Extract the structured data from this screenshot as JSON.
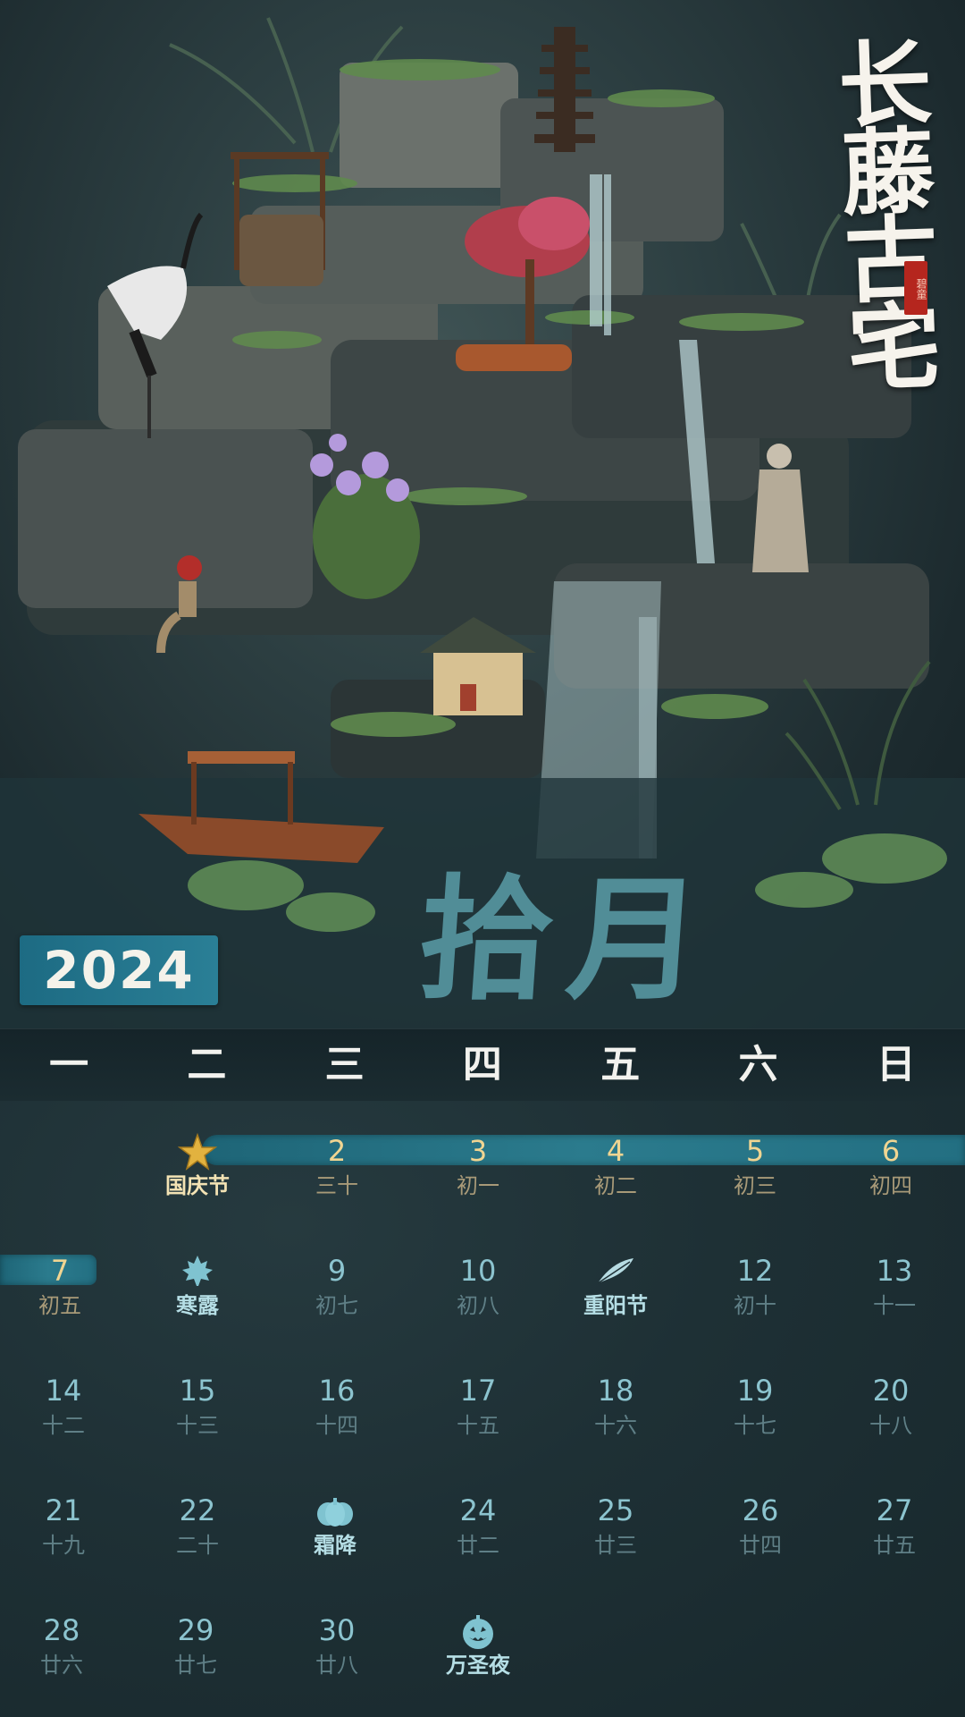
{
  "brand": {
    "title": "长藤古宅",
    "seal": "碧童"
  },
  "month_title": "拾月",
  "year": "2024",
  "weekdays": [
    "一",
    "二",
    "三",
    "四",
    "五",
    "六",
    "日"
  ],
  "calendar": {
    "week1": [
      {
        "icon": "star-icon",
        "lunar": "国庆节"
      },
      {
        "day": "2",
        "lunar": "三十"
      },
      {
        "day": "3",
        "lunar": "初一"
      },
      {
        "day": "4",
        "lunar": "初二"
      },
      {
        "day": "5",
        "lunar": "初三"
      },
      {
        "day": "6",
        "lunar": "初四"
      }
    ],
    "week2": [
      {
        "day": "7",
        "lunar": "初五"
      },
      {
        "icon": "maple-leaf-icon",
        "lunar": "寒露"
      },
      {
        "day": "9",
        "lunar": "初七"
      },
      {
        "day": "10",
        "lunar": "初八"
      },
      {
        "icon": "feather-icon",
        "lunar": "重阳节"
      },
      {
        "day": "12",
        "lunar": "初十"
      },
      {
        "day": "13",
        "lunar": "十一"
      }
    ],
    "week3": [
      {
        "day": "14",
        "lunar": "十二"
      },
      {
        "day": "15",
        "lunar": "十三"
      },
      {
        "day": "16",
        "lunar": "十四"
      },
      {
        "day": "17",
        "lunar": "十五"
      },
      {
        "day": "18",
        "lunar": "十六"
      },
      {
        "day": "19",
        "lunar": "十七"
      },
      {
        "day": "20",
        "lunar": "十八"
      }
    ],
    "week4": [
      {
        "day": "21",
        "lunar": "十九"
      },
      {
        "day": "22",
        "lunar": "二十"
      },
      {
        "icon": "pumpkin-icon",
        "lunar": "霜降"
      },
      {
        "day": "24",
        "lunar": "廿二"
      },
      {
        "day": "25",
        "lunar": "廿三"
      },
      {
        "day": "26",
        "lunar": "廿四"
      },
      {
        "day": "27",
        "lunar": "廿五"
      }
    ],
    "week5": [
      {
        "day": "28",
        "lunar": "廿六"
      },
      {
        "day": "29",
        "lunar": "廿七"
      },
      {
        "day": "30",
        "lunar": "廿八"
      },
      {
        "icon": "jack-o-lantern-icon",
        "lunar": "万圣夜"
      }
    ]
  },
  "colors": {
    "band": "#236f82",
    "day_number": "#8cc4cf",
    "band_day_number": "#f0d592",
    "lunar": "#5f7f86",
    "festival": "#f3e3b4"
  }
}
